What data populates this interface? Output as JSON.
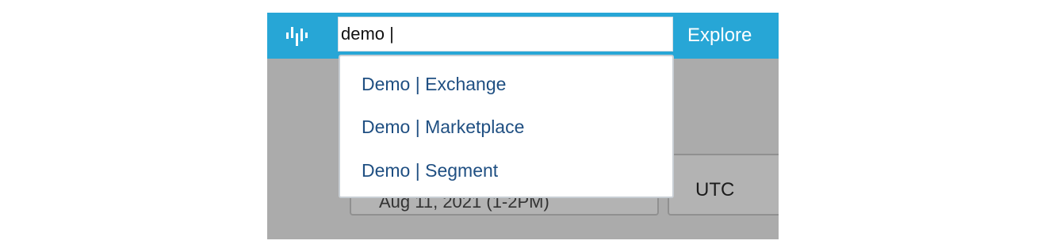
{
  "header": {
    "logo_icon": "waveform-logo-icon",
    "search": {
      "value": "demo |",
      "placeholder": ""
    },
    "explore_label": "Explore"
  },
  "autocomplete": {
    "options": [
      {
        "label": "Demo | Exchange"
      },
      {
        "label": "Demo | Marketplace"
      },
      {
        "label": "Demo | Segment"
      }
    ]
  },
  "background": {
    "date_range_label": "Aug 11, 2021 (1-2PM)",
    "timezone_label": "UTC"
  },
  "colors": {
    "header_bg": "#27a6d6",
    "overlay_bg": "#ababab",
    "option_text": "#1f4f82"
  }
}
